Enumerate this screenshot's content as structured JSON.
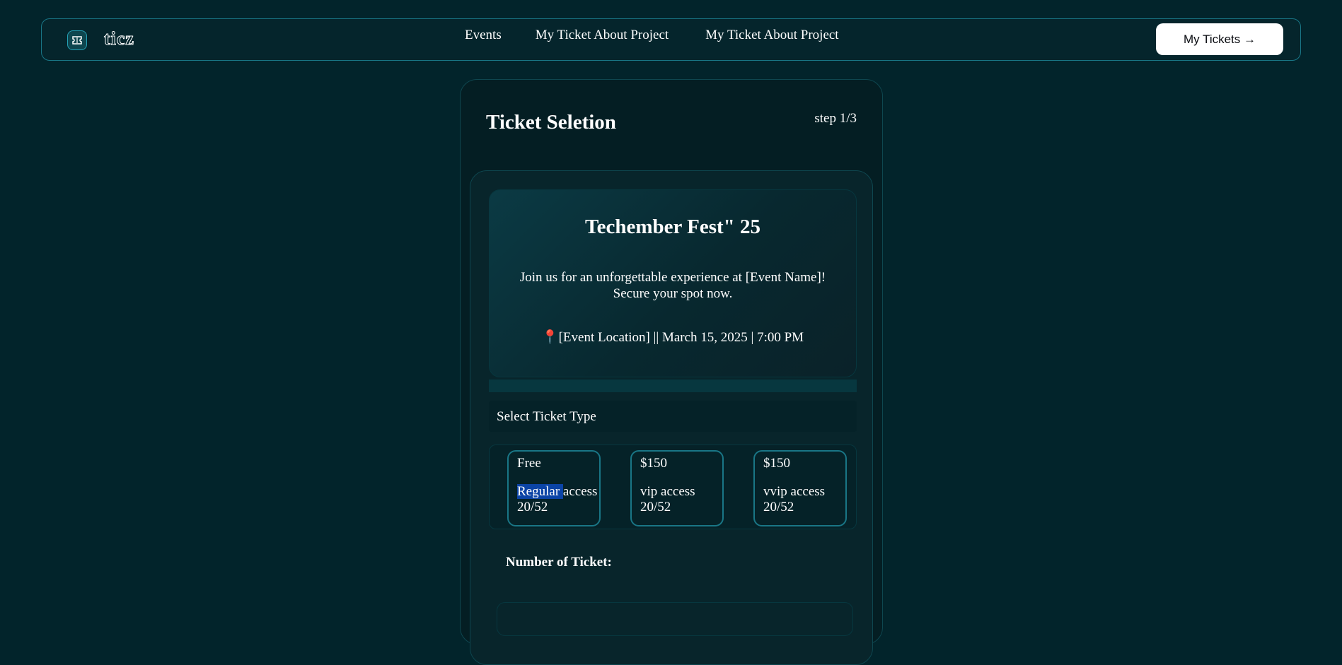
{
  "nav": {
    "logo_text": "ticz",
    "links": [
      "Events",
      "My Ticket About Project",
      "My Ticket About Project"
    ],
    "my_tickets_label": "My Tickets →"
  },
  "card": {
    "title": "Ticket Seletion",
    "step": "step 1/3"
  },
  "event": {
    "title": "Techember Fest\" 25",
    "desc_line1": "Join us for an unforgettable experience at [Event Name]!",
    "desc_line2": "Secure your spot now.",
    "pin": "📍",
    "meta": "[Event Location] || March 15, 2025 | 7:00 PM"
  },
  "tickets": {
    "section_label": "Select Ticket Type",
    "options": [
      {
        "price": "Free",
        "access_highlight": "Regular ",
        "access_rest": "access",
        "availability": "20/52"
      },
      {
        "price": "$150",
        "access": "vip access",
        "availability": "20/52"
      },
      {
        "price": "$150",
        "access": "vvip access",
        "availability": "20/52"
      }
    ]
  },
  "quantity": {
    "label": "Number of Ticket:"
  },
  "colors": {
    "background": "#02242b",
    "border_accent": "#197686",
    "highlight": "#0b44a6"
  }
}
